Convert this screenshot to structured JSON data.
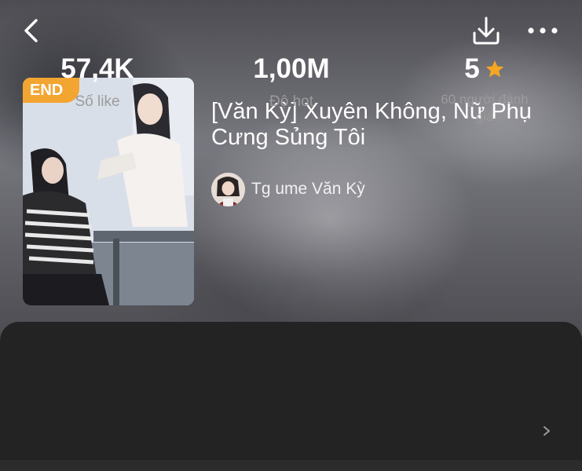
{
  "header": {
    "back_icon": "chevron-left-icon",
    "download_icon": "download-icon",
    "more_icon": "more-horizontal-icon"
  },
  "book": {
    "status_badge": "END",
    "title": "[Văn Kỳ] Xuyên Không, Nữ Phụ Cưng Sủng Tôi",
    "author": "Tg ume Văn Kỳ"
  },
  "stats": {
    "likes_value": "57,4K",
    "likes_label": "Số like",
    "hot_value": "1,00M",
    "hot_label": "Độ hot",
    "rating_value": "5",
    "rating_label": "60 người đánh giá",
    "star_color": "#f5a623"
  },
  "colors": {
    "badge": "#f3a532",
    "panel": "#232323",
    "muted_text": "#9b9b9b"
  }
}
